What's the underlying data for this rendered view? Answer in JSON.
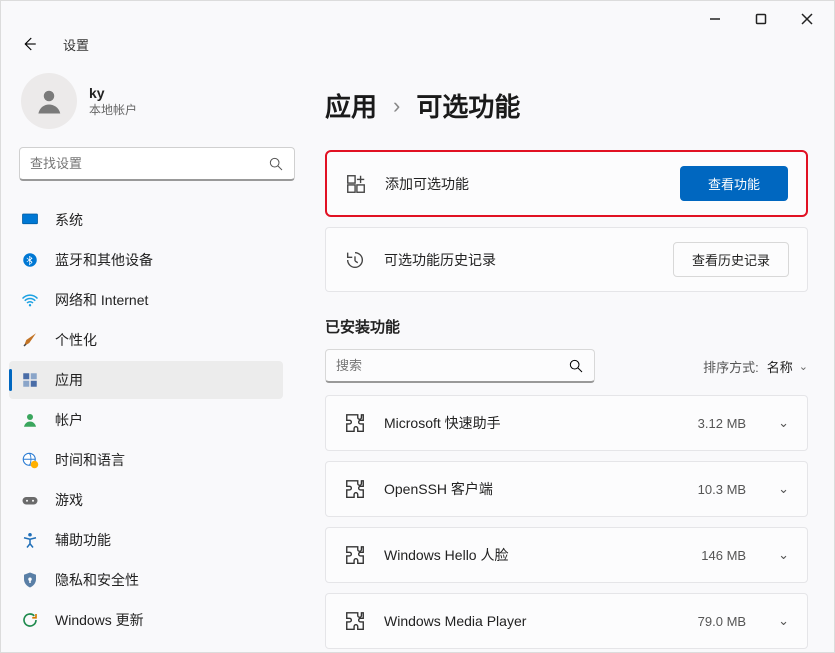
{
  "window": {
    "app_name": "设置"
  },
  "profile": {
    "name": "ky",
    "account_type": "本地帐户"
  },
  "sidebar_search": {
    "placeholder": "查找设置"
  },
  "nav": [
    {
      "id": "system",
      "label": "系统"
    },
    {
      "id": "bluetooth",
      "label": "蓝牙和其他设备"
    },
    {
      "id": "network",
      "label": "网络和 Internet"
    },
    {
      "id": "personal",
      "label": "个性化"
    },
    {
      "id": "apps",
      "label": "应用",
      "active": true
    },
    {
      "id": "accounts",
      "label": "帐户"
    },
    {
      "id": "time",
      "label": "时间和语言"
    },
    {
      "id": "gaming",
      "label": "游戏"
    },
    {
      "id": "access",
      "label": "辅助功能"
    },
    {
      "id": "privacy",
      "label": "隐私和安全性"
    },
    {
      "id": "update",
      "label": "Windows 更新"
    }
  ],
  "breadcrumb": {
    "part1": "应用",
    "part2": "可选功能"
  },
  "cards": {
    "add": {
      "label": "添加可选功能",
      "button": "查看功能"
    },
    "history": {
      "label": "可选功能历史记录",
      "button": "查看历史记录"
    }
  },
  "installed": {
    "title": "已安装功能",
    "search_placeholder": "搜索",
    "sort_label": "排序方式:",
    "sort_value": "名称",
    "items": [
      {
        "name": "Microsoft 快速助手",
        "size": "3.12 MB"
      },
      {
        "name": "OpenSSH 客户端",
        "size": "10.3 MB"
      },
      {
        "name": "Windows Hello 人脸",
        "size": "146 MB"
      },
      {
        "name": "Windows Media Player",
        "size": "79.0 MB"
      }
    ]
  }
}
